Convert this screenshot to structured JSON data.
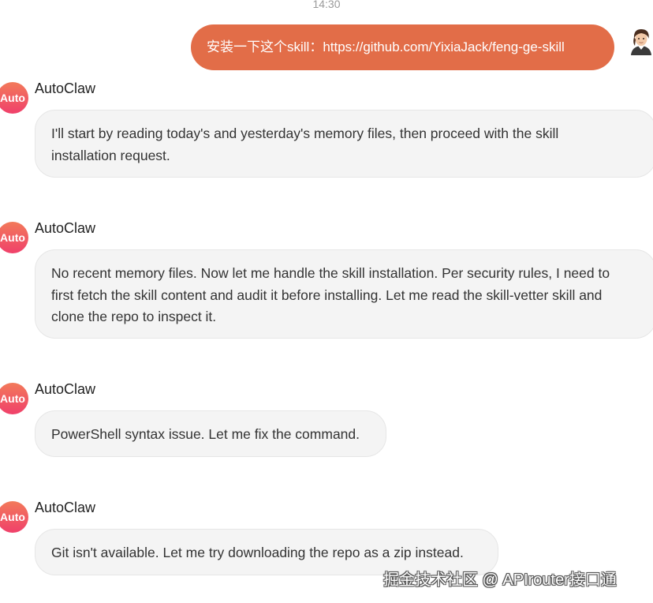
{
  "header": {
    "timestamp": "14:30"
  },
  "user_message": {
    "text": "安装一下这个skill：https://github.com/YixiaJack/feng-ge-skill",
    "avatar_icon": "user-avatar-icon",
    "bubble_color": "#e26d48"
  },
  "bot": {
    "avatar_label": "Auto",
    "avatar_colors": [
      "#f27a5a",
      "#f0406a"
    ]
  },
  "messages": [
    {
      "sender": "AutoClaw",
      "lines": [
        "I'll start by reading today's and yesterday's memory files, then proceed with the skill",
        "installation request."
      ]
    },
    {
      "sender": "AutoClaw",
      "lines": [
        "No recent memory files. Now let me handle the skill installation. Per security rules, I need to",
        "first fetch the skill content and audit it before installing. Let me read the skill-vetter skill and",
        "clone the repo to inspect it."
      ]
    },
    {
      "sender": "AutoClaw",
      "lines": [
        "PowerShell syntax issue. Let me fix the command."
      ]
    },
    {
      "sender": "AutoClaw",
      "lines": [
        "Git isn't available. Let me try downloading the repo as a zip instead."
      ]
    }
  ],
  "watermark": {
    "text": "掘金技术社区 @ APIrouter接口通"
  }
}
